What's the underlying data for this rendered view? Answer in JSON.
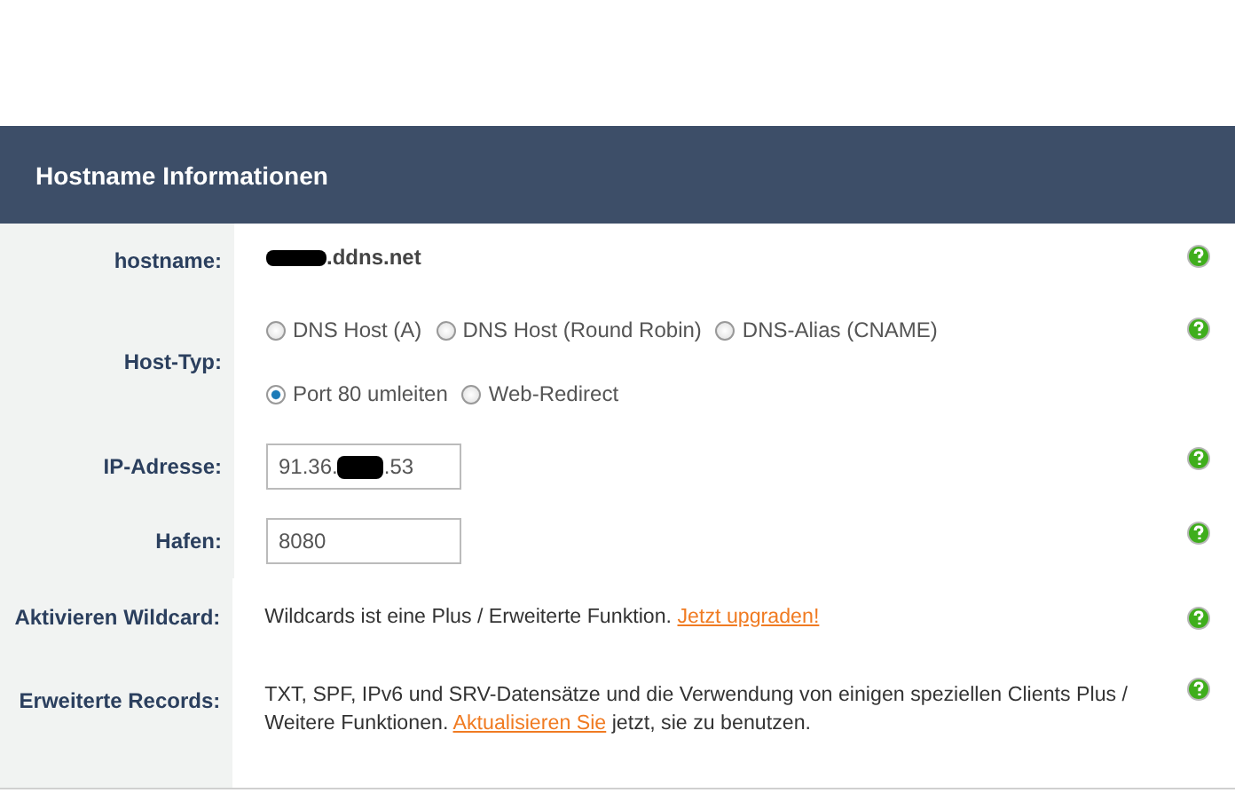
{
  "panel": {
    "title": "Hostname Informationen"
  },
  "rows": [
    {
      "kind": "hostname",
      "label": "hostname:",
      "redacted": true,
      "value": ".ddns.net"
    },
    {
      "kind": "radio",
      "label": "Host-Typ:",
      "lines": [
        [
          {
            "label": "DNS Host (A)",
            "selected": false
          },
          {
            "label": "DNS Host (Round Robin)",
            "selected": false
          },
          {
            "label": "DNS-Alias (CNAME)",
            "selected": false
          }
        ],
        [
          {
            "label": "Port 80 umleiten",
            "selected": true
          },
          {
            "label": "Web-Redirect",
            "selected": false
          }
        ]
      ]
    },
    {
      "kind": "input",
      "label": "IP-Adresse:",
      "value": "91.36.",
      "redacted": true,
      "value_tail": ".53"
    },
    {
      "kind": "input",
      "label": "Hafen:",
      "value": "8080",
      "redacted": false
    },
    {
      "kind": "note",
      "label": "Aktivieren Wildcard:",
      "text": "Wildcards ist eine Plus / Erweiterte Funktion.",
      "link": "Jetzt upgraden!"
    },
    {
      "kind": "note",
      "label": "Erweiterte Records:",
      "text": "TXT, SPF, IPv6 und SRV-Datensätze und die Verwendung von einigen speziellen Clients Plus / Weitere Funktionen.",
      "link": "Aktualisieren Sie",
      "text_after": "jetzt, sie zu benutzen."
    }
  ]
}
